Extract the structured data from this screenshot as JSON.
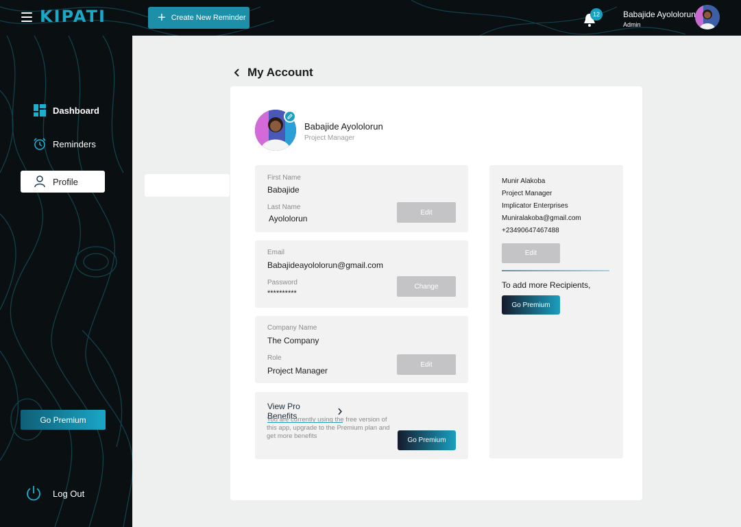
{
  "app": {
    "logo": "KIPATI"
  },
  "header": {
    "create_button": "Create New Reminder",
    "notification_count": "12",
    "user_name": "Babajide Ayololorun",
    "user_role": "Admin"
  },
  "sidebar": {
    "items": [
      {
        "label": "Dashboard",
        "icon": "dashboard-icon"
      },
      {
        "label": "Reminders",
        "icon": "alarm-clock-icon"
      },
      {
        "label": "Profile",
        "icon": "user-icon"
      }
    ],
    "premium_button": "Go Premium",
    "logout": "Log Out"
  },
  "page": {
    "title": "My Account"
  },
  "profile": {
    "name": "Babajide Ayololorun",
    "role": "Project Manager"
  },
  "fields": {
    "first_name_label": "First Name",
    "first_name": "Babajide",
    "last_name_label": "Last Name",
    "last_name": "Ayololorun",
    "name_edit": "Edit",
    "email_label": "Email",
    "email": "Babajideayololorun@gmail.com",
    "password_label": "Password",
    "password": "**********",
    "change": "Change",
    "company_label": "Company Name",
    "company": "The Company",
    "role_label": "Role",
    "role": "Project Manager",
    "company_edit": "Edit"
  },
  "pro": {
    "link": "View Pro Benefits",
    "description": "You are currently using the free version of this app, upgrade to the Premium plan and get more benefits",
    "button": "Go Premium"
  },
  "recipient": {
    "name": "Munir Alakoba",
    "role": "Project Manager",
    "company": "Implicator Enterprises",
    "email": "Muniralakoba@gmail.com",
    "phone": "+23490647467488",
    "edit": "Edit",
    "add_more": "To add more Recipients,",
    "premium_button": "Go Premium"
  },
  "colors": {
    "accent": "#1aa0bf",
    "dark": "#0a0f12",
    "panel": "#f2f2f2"
  }
}
